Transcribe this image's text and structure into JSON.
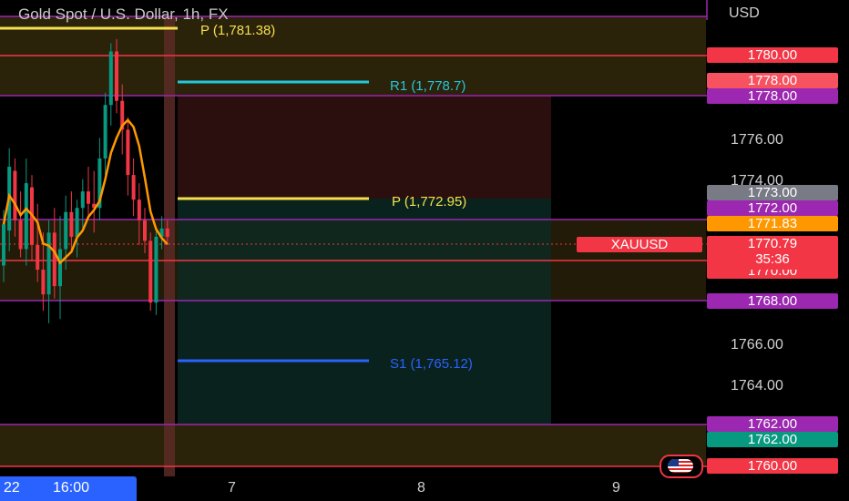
{
  "header": {
    "title": "Gold Spot / U.S. Dollar, 1h, FX",
    "currency": "USD"
  },
  "pivots": {
    "p_prev": "P (1,781.38)",
    "r1": "R1 (1,778.7)",
    "p": "P (1,772.95)",
    "s1": "S1 (1,765.12)"
  },
  "price_axis": {
    "ticks": [
      "1776.00",
      "1774.00",
      "1766.00",
      "1764.00"
    ]
  },
  "price_labels": [
    {
      "text": "1780.00",
      "color": "#f23645"
    },
    {
      "text": "1778.00",
      "color": "#f7525f"
    },
    {
      "text": "1778.00",
      "color": "#9c27b0"
    },
    {
      "text": "1773.00",
      "color": "#787b86"
    },
    {
      "text": "1772.00",
      "color": "#9c27b0"
    },
    {
      "text": "1771.83",
      "color": "#ff9800"
    },
    {
      "text": "1770.00",
      "color": "#f23645"
    },
    {
      "text": "1768.00",
      "color": "#9c27b0"
    },
    {
      "text": "1762.00",
      "color": "#9c27b0"
    },
    {
      "text": "1762.00",
      "color": "#089981"
    },
    {
      "text": "1760.00",
      "color": "#f23645"
    }
  ],
  "ticker": {
    "symbol": "XAUUSD",
    "last_price": "1770.79",
    "countdown": "35:36"
  },
  "time_axis": {
    "date_fragment": "22",
    "time": "16:00",
    "labels": [
      "7",
      "8",
      "9"
    ]
  },
  "colors": {
    "up": "#089981",
    "down": "#f23645",
    "ma": "#ff9800",
    "zone": "#3a2a08",
    "purple": "#9c27b0"
  },
  "chart_data": {
    "type": "candlestick",
    "title": "Gold Spot / U.S. Dollar, 1h, FX",
    "ylim": [
      1759.6,
      1783.0
    ],
    "overlay_ma": {
      "color": "#ff9800"
    },
    "horizontal_levels": [
      1780.0,
      1778.0,
      1772.0,
      1770.0,
      1768.0,
      1762.0,
      1760.0
    ],
    "candles": [
      {
        "o": 1769.8,
        "h": 1772.5,
        "l": 1769.0,
        "c": 1771.8
      },
      {
        "o": 1771.5,
        "h": 1775.5,
        "l": 1770.5,
        "c": 1774.6
      },
      {
        "o": 1774.4,
        "h": 1775.0,
        "l": 1771.2,
        "c": 1772.0
      },
      {
        "o": 1772.0,
        "h": 1773.4,
        "l": 1770.2,
        "c": 1770.6
      },
      {
        "o": 1770.6,
        "h": 1775.0,
        "l": 1769.8,
        "c": 1773.8
      },
      {
        "o": 1773.6,
        "h": 1774.2,
        "l": 1770.0,
        "c": 1770.8
      },
      {
        "o": 1770.8,
        "h": 1772.8,
        "l": 1769.0,
        "c": 1769.6
      },
      {
        "o": 1769.6,
        "h": 1771.4,
        "l": 1767.6,
        "c": 1768.4
      },
      {
        "o": 1768.4,
        "h": 1772.0,
        "l": 1767.0,
        "c": 1771.4
      },
      {
        "o": 1771.4,
        "h": 1772.6,
        "l": 1768.2,
        "c": 1768.8
      },
      {
        "o": 1768.8,
        "h": 1772.2,
        "l": 1767.2,
        "c": 1770.6
      },
      {
        "o": 1770.6,
        "h": 1773.2,
        "l": 1769.6,
        "c": 1772.4
      },
      {
        "o": 1772.4,
        "h": 1773.4,
        "l": 1770.6,
        "c": 1771.2
      },
      {
        "o": 1771.2,
        "h": 1773.0,
        "l": 1770.2,
        "c": 1772.6
      },
      {
        "o": 1772.6,
        "h": 1774.0,
        "l": 1771.6,
        "c": 1773.4
      },
      {
        "o": 1773.4,
        "h": 1774.6,
        "l": 1772.2,
        "c": 1772.8
      },
      {
        "o": 1772.8,
        "h": 1774.4,
        "l": 1771.4,
        "c": 1772.6
      },
      {
        "o": 1772.6,
        "h": 1776.0,
        "l": 1772.0,
        "c": 1775.0
      },
      {
        "o": 1775.0,
        "h": 1778.2,
        "l": 1774.2,
        "c": 1777.6
      },
      {
        "o": 1777.6,
        "h": 1780.6,
        "l": 1776.6,
        "c": 1780.2
      },
      {
        "o": 1780.2,
        "h": 1780.8,
        "l": 1777.2,
        "c": 1777.8
      },
      {
        "o": 1777.8,
        "h": 1778.6,
        "l": 1775.2,
        "c": 1776.4
      },
      {
        "o": 1776.4,
        "h": 1777.0,
        "l": 1773.2,
        "c": 1774.2
      },
      {
        "o": 1774.2,
        "h": 1775.0,
        "l": 1772.2,
        "c": 1773.0
      },
      {
        "o": 1773.0,
        "h": 1773.8,
        "l": 1770.8,
        "c": 1772.0
      },
      {
        "o": 1772.0,
        "h": 1772.6,
        "l": 1770.4,
        "c": 1771.0
      },
      {
        "o": 1771.0,
        "h": 1771.4,
        "l": 1767.6,
        "c": 1768.0
      },
      {
        "o": 1768.0,
        "h": 1771.6,
        "l": 1767.4,
        "c": 1771.2
      },
      {
        "o": 1771.2,
        "h": 1772.2,
        "l": 1770.6,
        "c": 1771.6
      },
      {
        "o": 1771.6,
        "h": 1772.0,
        "l": 1770.8,
        "c": 1771.2
      }
    ]
  }
}
